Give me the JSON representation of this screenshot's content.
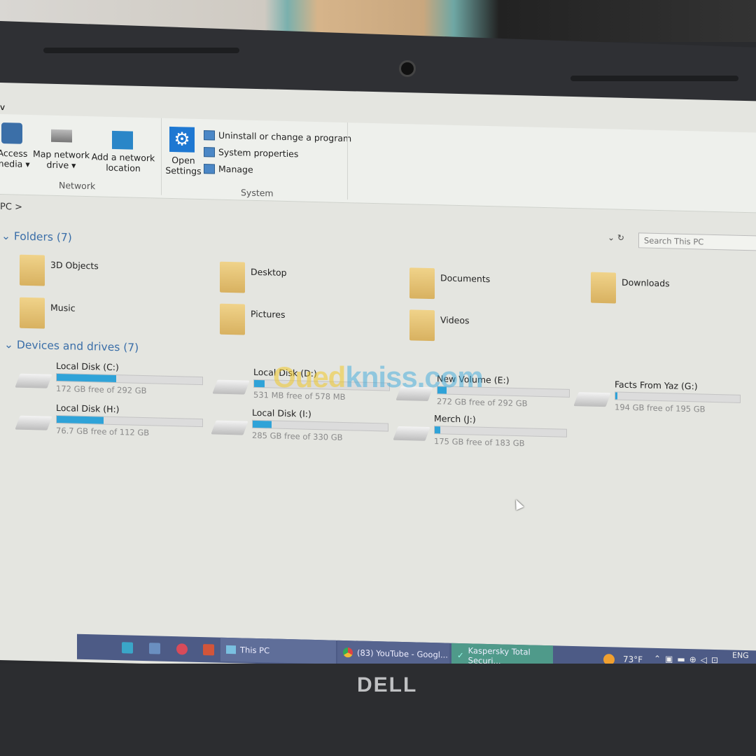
{
  "ribbon": {
    "network": {
      "label": "Network",
      "items": [
        {
          "label": "Access media ▾",
          "icon": "media-icon"
        },
        {
          "label": "Map network drive ▾",
          "icon": "network-drive-icon"
        },
        {
          "label": "Add a network location",
          "icon": "network-location-icon"
        }
      ]
    },
    "system": {
      "label": "System",
      "open_settings": "Open Settings",
      "items": [
        "Uninstall or change a program",
        "System properties",
        "Manage"
      ]
    },
    "menu_fragment": "v"
  },
  "address": {
    "path": "PC",
    "separator": ">"
  },
  "search": {
    "placeholder": "Search This PC"
  },
  "folders": {
    "header": "Folders (7)",
    "items": [
      "3D Objects",
      "Desktop",
      "Documents",
      "Downloads",
      "Music",
      "Pictures",
      "Videos"
    ]
  },
  "drives": {
    "header": "Devices and drives (7)",
    "items": [
      {
        "name": "Local Disk (C:)",
        "free": "172 GB free of 292 GB",
        "used_fraction": 0.41
      },
      {
        "name": "Local Disk (D:)",
        "free": "531 MB free of 578 MB",
        "used_fraction": 0.08
      },
      {
        "name": "New Volume (E:)",
        "free": "272 GB free of 292 GB",
        "used_fraction": 0.07
      },
      {
        "name": "Facts From Yaz (G:)",
        "free": "194 GB free of 195 GB",
        "used_fraction": 0.005
      },
      {
        "name": "Local Disk (H:)",
        "free": "76.7 GB free of 112 GB",
        "used_fraction": 0.32
      },
      {
        "name": "Local Disk (I:)",
        "free": "285 GB free of 330 GB",
        "used_fraction": 0.14
      },
      {
        "name": "Merch  (J:)",
        "free": "175 GB free of 183 GB",
        "used_fraction": 0.04
      }
    ]
  },
  "taskbar": {
    "apps": [
      "This PC",
      "(83) YouTube - Googl...",
      "Kaspersky Total Securi..."
    ],
    "weather": "73°F",
    "language": "ENG"
  },
  "brand": "DELL",
  "watermark": "Ouedkniss.com",
  "colors": {
    "accent": "#2fa3d8",
    "taskbar": "#4d5b86",
    "section": "#3a6ea8"
  }
}
